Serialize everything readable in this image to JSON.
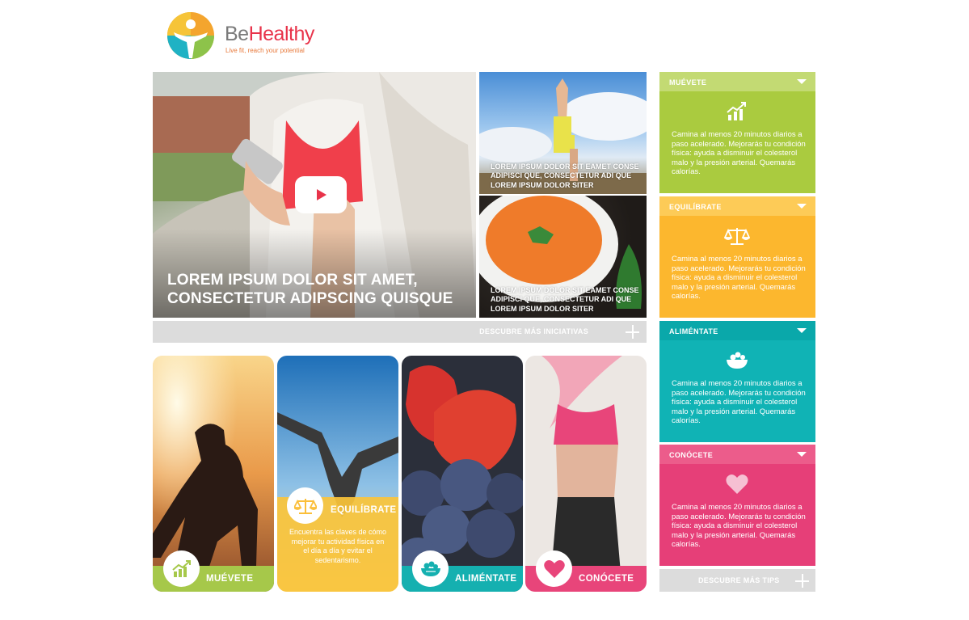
{
  "brand": {
    "name_part1": "Be",
    "name_part2": "Healthy",
    "tagline": "Live fit, reach your potential"
  },
  "hero": {
    "title": "LOREM IPSUM DOLOR SIT AMET, CONSECTETUR ADIPSCING QUISQUE",
    "play_icon": "play-icon"
  },
  "side_tiles": [
    {
      "caption": "LOREM IPSUM DOLOR SIT EAMET CONSE ADIPISCI QUE, CONSECTETUR ADI QUE LOREM IPSUM DOLOR SITER"
    },
    {
      "caption": "LOREM IPSUM DOLOR SIT EAMET CONSE ADIPISCI QUE, CONSECTETUR ADI QUE LOREM IPSUM DOLOR SITER"
    }
  ],
  "initiatives_more": "DESCUBRE MÁS INICIATIVAS",
  "cards": [
    {
      "label": "MUÉVETE",
      "icon": "growth-chart-icon",
      "color": "#a6c84a"
    },
    {
      "label": "EQUILÍBRATE",
      "icon": "balance-scale-icon",
      "color": "#fbbf3a",
      "desc": "Encuentra las claves de cómo mejorar tu actividad física en el día a día y evitar el sedentarismo."
    },
    {
      "label": "ALIMÉNTATE",
      "icon": "food-bowl-icon",
      "color": "#15b0b0"
    },
    {
      "label": "CONÓCETE",
      "icon": "heart-icon",
      "color": "#e8457a"
    }
  ],
  "accordion": [
    {
      "title": "MUÉVETE",
      "icon": "growth-chart-icon",
      "color": "#aacb3f",
      "head_color": "#c3da73",
      "text": "Camina al menos 20 minutos diarios a paso acelerado. Mejorarás tu condición física: ayuda a disminuir el colesterol malo y la presión arterial. Quemarás calorías."
    },
    {
      "title": "EQUILÍBRATE",
      "icon": "balance-scale-icon",
      "color": "#fcb72e",
      "head_color": "#fdcb57",
      "text": "Camina al menos 20 minutos diarios a paso acelerado. Mejorarás tu condición física: ayuda a disminuir el colesterol malo y la presión arterial. Quemarás calorías."
    },
    {
      "title": "ALIMÉNTATE",
      "icon": "food-bowl-icon",
      "color": "#10b3b5",
      "head_color": "#0aa8aa",
      "text": "Camina al menos 20 minutos diarios a paso acelerado. Mejorarás tu condición física: ayuda a disminuir el colesterol malo y la presión arterial. Quemarás calorías."
    },
    {
      "title": "CONÓCETE",
      "icon": "heart-icon",
      "color": "#e63f78",
      "head_color": "#ec5c8b",
      "text": "Camina al menos 20 minutos diarios a paso acelerado. Mejorarás tu condición física: ayuda a disminuir el colesterol malo y la presión arterial. Quemarás calorías."
    }
  ],
  "tips_more": "DESCUBRE MÁS TIPS"
}
